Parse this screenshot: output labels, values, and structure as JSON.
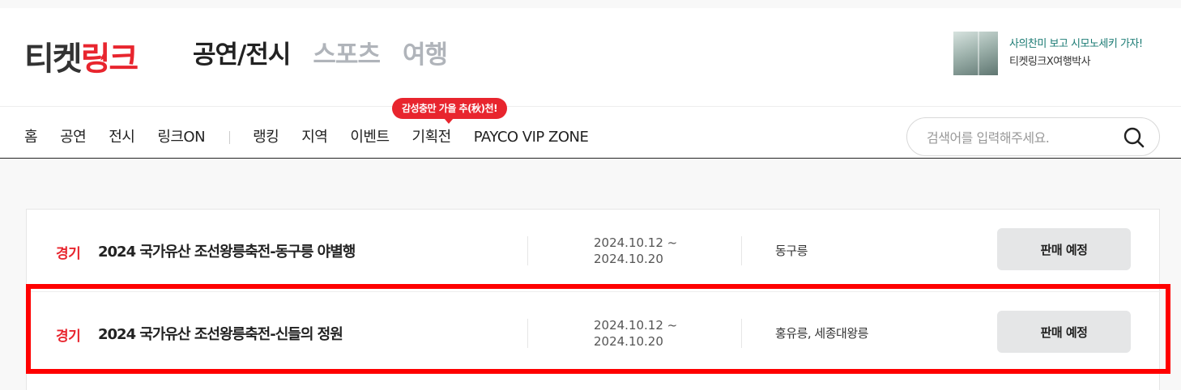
{
  "logo": {
    "part1": "티켓",
    "part2": "링크"
  },
  "categories": [
    {
      "label": "공연/전시",
      "active": true
    },
    {
      "label": "스포츠",
      "active": false
    },
    {
      "label": "여행",
      "active": false
    }
  ],
  "promo_banner": {
    "title": "사의찬미 보고 시모노세키 가자!",
    "subtitle": "티켓링크X여행박사"
  },
  "menu": {
    "primary": [
      "홈",
      "공연",
      "전시",
      "링크ON"
    ],
    "secondary": [
      "랭킹",
      "지역",
      "이벤트",
      "기획전",
      "PAYCO VIP ZONE"
    ],
    "bubble": "감성충만 가을 추(秋)천!"
  },
  "search": {
    "placeholder": "검색어를 입력해주세요.",
    "value": ""
  },
  "listings": [
    {
      "region": "경기",
      "title": "2024 국가유산 조선왕릉축전-동구릉 야별행",
      "date_start": "2024.10.12 ~",
      "date_end": "2024.10.20",
      "venue": "동구릉",
      "status": "판매 예정"
    },
    {
      "region": "경기",
      "title": "2024 국가유산 조선왕릉축전-신들의 정원",
      "date_start": "2024.10.12 ~",
      "date_end": "2024.10.20",
      "venue": "홍유릉, 세종대왕릉",
      "status": "판매 예정"
    }
  ],
  "colors": {
    "brand_red": "#e8252e",
    "highlight": "#ff0000",
    "banner_teal": "#1a7a73"
  }
}
